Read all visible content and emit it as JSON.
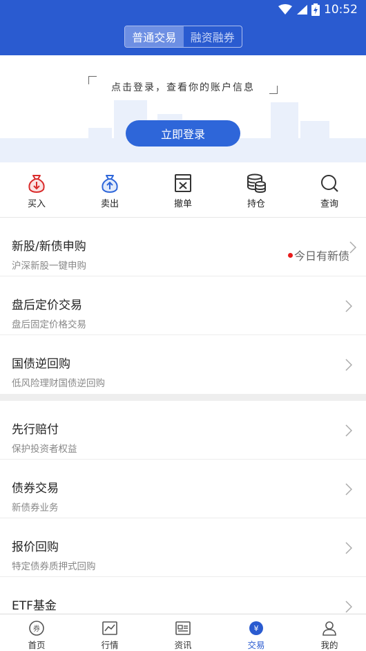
{
  "status_bar": {
    "time": "10:52"
  },
  "header": {
    "segments": [
      {
        "label": "普通交易",
        "active": true
      },
      {
        "label": "融资融券",
        "active": false
      }
    ]
  },
  "login_banner": {
    "prompt": "点击登录，查看你的账户信息",
    "login_button": "立即登录"
  },
  "quick_actions": [
    {
      "label": "买入",
      "icon": "buy-icon"
    },
    {
      "label": "卖出",
      "icon": "sell-icon"
    },
    {
      "label": "撤单",
      "icon": "cancel-order-icon"
    },
    {
      "label": "持仓",
      "icon": "holdings-icon"
    },
    {
      "label": "查询",
      "icon": "query-icon"
    }
  ],
  "list_group_1": [
    {
      "title": "新股/新债申购",
      "subtitle": "沪深新股一键申购",
      "badge": "今日有新债"
    },
    {
      "title": "盘后定价交易",
      "subtitle": "盘后固定价格交易"
    },
    {
      "title": "国债逆回购",
      "subtitle": "低风险理财国债逆回购"
    }
  ],
  "list_group_2": [
    {
      "title": "先行赔付",
      "subtitle": "保护投资者权益"
    },
    {
      "title": "债券交易",
      "subtitle": "新债券业务"
    },
    {
      "title": "报价回购",
      "subtitle": "特定债券质押式回购"
    },
    {
      "title": "ETF基金",
      "subtitle": ""
    }
  ],
  "tab_bar": [
    {
      "label": "首页",
      "icon": "home-icon",
      "active": false
    },
    {
      "label": "行情",
      "icon": "market-icon",
      "active": false
    },
    {
      "label": "资讯",
      "icon": "news-icon",
      "active": false
    },
    {
      "label": "交易",
      "icon": "trade-icon",
      "active": true
    },
    {
      "label": "我的",
      "icon": "profile-icon",
      "active": false
    }
  ],
  "colors": {
    "brand_blue": "#2a5bd0",
    "button_blue": "#2e66d9",
    "alert_red": "#e81b1b"
  }
}
